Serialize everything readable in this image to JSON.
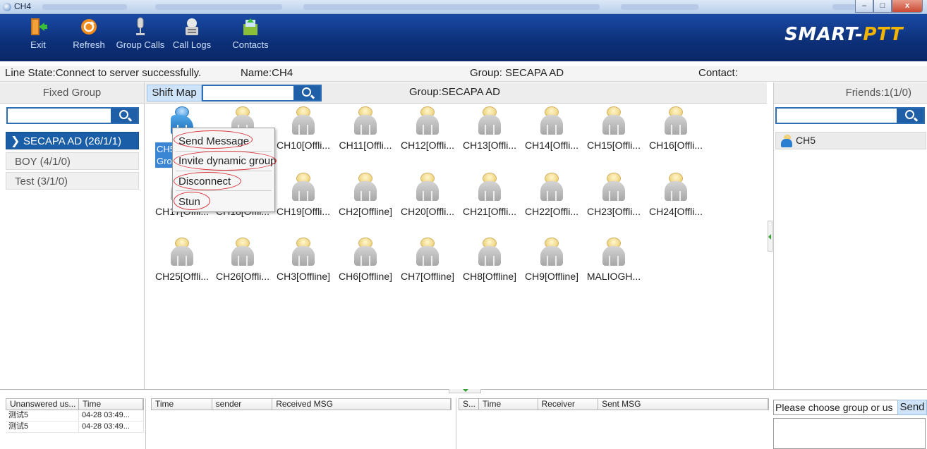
{
  "window": {
    "title": "CH4",
    "controls": [
      "–",
      "□",
      "x"
    ]
  },
  "toolbar": {
    "items": [
      {
        "label": "Exit",
        "icon": "exit-door-icon"
      },
      {
        "label": "Refresh",
        "icon": "refresh-icon"
      },
      {
        "label": "Group Calls",
        "icon": "microphone-icon"
      },
      {
        "label": "Call Logs",
        "icon": "call-logs-icon"
      },
      {
        "label": "Contacts",
        "icon": "contacts-icon"
      }
    ],
    "brand_main": "SMART-",
    "brand_accent": "PTT"
  },
  "status": {
    "line_state": "Line State:Connect to server successfully.",
    "name": "Name:CH4",
    "group": "Group: SECAPA AD",
    "contact": "Contact:"
  },
  "left_panel": {
    "header": "Fixed Group",
    "search_value": "",
    "groups": [
      {
        "label": "SECAPA AD (26/1/1)",
        "active": true
      },
      {
        "label": "BOY (4/1/0)",
        "active": false
      },
      {
        "label": "Test (3/1/0)",
        "active": false
      }
    ]
  },
  "center": {
    "shift_map_label": "Shift Map",
    "search_value": "",
    "title": "Group:SECAPA AD",
    "selected_user_label": "CH5 Gro",
    "users_row1": [
      "CH10[Offli...",
      "CH11[Offli...",
      "CH12[Offli...",
      "CH13[Offli...",
      "CH14[Offli...",
      "CH15[Offli...",
      "CH16[Offli..."
    ],
    "users_row2": [
      "CH17[Offli...",
      "CH18[Offli...",
      "CH19[Offli...",
      "CH2[Offline]",
      "CH20[Offli...",
      "CH21[Offli...",
      "CH22[Offli...",
      "CH23[Offli...",
      "CH24[Offli..."
    ],
    "users_row3": [
      "CH25[Offli...",
      "CH26[Offli...",
      "CH3[Offline]",
      "CH6[Offline]",
      "CH7[Offline]",
      "CH8[Offline]",
      "CH9[Offline]",
      "MALIOGH..."
    ]
  },
  "context_menu": {
    "items": [
      "Send Message",
      "Invite dynamic group",
      "Disconnect",
      "Stun"
    ],
    "highlight_color": "#d9343a"
  },
  "right_panel": {
    "header": "Friends:1(1/0)",
    "search_value": "",
    "friends": [
      "CH5"
    ]
  },
  "bottom": {
    "unanswered_table": {
      "headers": [
        "Unanswered us...",
        "Time"
      ],
      "rows": [
        [
          "测试5",
          "04-28 03:49..."
        ],
        [
          "测试5",
          "04-28 03:49..."
        ]
      ]
    },
    "received_table": {
      "headers": [
        "Time",
        "sender",
        "Received MSG"
      ]
    },
    "sent_table": {
      "headers": [
        "S...",
        "Time",
        "Receiver",
        "Sent MSG"
      ]
    },
    "message_placeholder": "Please choose group or us",
    "send_label": "Send"
  },
  "colors": {
    "toolbar_bg": "#0c2f77",
    "accent_blue": "#1e5fa8",
    "brand_accent": "#f3b400",
    "online_user": "#1d6ab8"
  }
}
